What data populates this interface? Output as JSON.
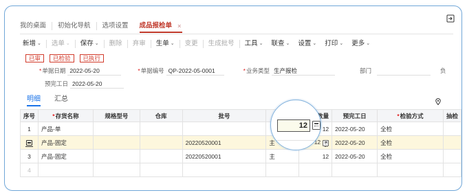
{
  "tabs": [
    {
      "label": "我的桌面"
    },
    {
      "label": "初始化导航"
    },
    {
      "label": "选项设置"
    },
    {
      "label": "成品报检单",
      "close": "×"
    }
  ],
  "toolbar": [
    {
      "label": "新增",
      "caret": "⌄",
      "disabled": false
    },
    {
      "label": "选单",
      "caret": "⌄",
      "disabled": true
    },
    {
      "label": "保存",
      "caret": "⌄",
      "disabled": false
    },
    {
      "label": "删除",
      "disabled": true
    },
    {
      "label": "弃审",
      "disabled": true
    },
    {
      "label": "生单",
      "caret": "⌄",
      "disabled": false
    },
    {
      "label": "变更",
      "disabled": true
    },
    {
      "label": "生成批号",
      "disabled": true
    },
    {
      "label": "工具",
      "caret": "⌄",
      "disabled": false
    },
    {
      "label": "联查",
      "caret": "⌄",
      "disabled": false
    },
    {
      "label": "设置",
      "caret": "⌄",
      "disabled": false
    },
    {
      "label": "打印",
      "caret": "⌄",
      "disabled": false
    },
    {
      "label": "更多",
      "caret": "⌄",
      "disabled": false
    }
  ],
  "badges": [
    "已审",
    "已检验",
    "已执行"
  ],
  "form": {
    "doc_date_label": "单据日期",
    "doc_date": "2022-05-20",
    "doc_no_label": "单据编号",
    "doc_no": "QP-2022-05-0001",
    "biz_type_label": "业务类型",
    "biz_type": "生产报检",
    "dept_label": "部门",
    "dept": "",
    "cut_label": "负",
    "plan_date_label": "预完工日",
    "plan_date": "2022-05-20",
    "required_mark": "*"
  },
  "subtabs": [
    "明细",
    "汇总"
  ],
  "icons": {
    "corner": "external-link-icon",
    "pin": "location-pin-icon",
    "row": "row-marker-icon",
    "calc": "calculator-icon"
  },
  "colors": {
    "accent": "#c0392b",
    "link": "#1a73e8",
    "selected_row": "#fdf7dd",
    "frame": "#6fa6d8"
  },
  "table": {
    "headers": [
      "序号",
      "*存货名称",
      "规格型号",
      "仓库",
      "批号",
      "",
      "检数量",
      "预完工日",
      "*检验方式",
      "抽检"
    ],
    "rows": [
      {
        "no": "1",
        "name": "产品-单",
        "spec": "",
        "wh": "",
        "batch": "",
        "unit": "",
        "qty": "12",
        "date": "2022-05-20",
        "method": "全检",
        "sample": "",
        "selected": false
      },
      {
        "no": "",
        "name": "产品-固定",
        "spec": "",
        "wh": "",
        "batch": "20220520001",
        "unit": "主",
        "qty": "12",
        "date": "2022-05-20",
        "method": "全检",
        "sample": "",
        "selected": true
      },
      {
        "no": "3",
        "name": "产品-固定",
        "spec": "",
        "wh": "",
        "batch": "20220520001",
        "unit": "主",
        "qty": "12",
        "date": "2022-05-20",
        "method": "全检",
        "sample": "",
        "selected": false
      },
      {
        "no": "4",
        "name": "",
        "spec": "",
        "wh": "",
        "batch": "",
        "unit": "",
        "qty": "",
        "date": "",
        "method": "",
        "sample": "",
        "selected": false
      }
    ]
  },
  "magnifier": {
    "value": "12"
  }
}
